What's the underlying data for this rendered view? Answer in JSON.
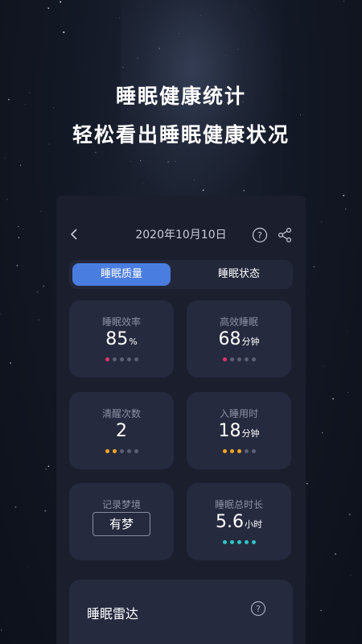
{
  "hero": {
    "title": "睡眠健康统计",
    "subtitle": "轻松看出睡眠健康状况"
  },
  "header": {
    "back_icon": "chevron-left-icon",
    "date": "2020年10月10日",
    "help_icon": "question-circle-icon",
    "share_icon": "share-icon"
  },
  "tabs": [
    {
      "label": "睡眠质量",
      "active": true
    },
    {
      "label": "睡眠状态",
      "active": false
    }
  ],
  "colors": {
    "accent": "#4a7de0",
    "rating_pink": "#e0336f",
    "rating_orange": "#f5a623",
    "rating_teal": "#2ec4c4",
    "rating_off": "#5c6072"
  },
  "stats": {
    "efficiency": {
      "label": "睡眠效率",
      "value": "85",
      "unit": "%",
      "rating": 1,
      "rating_max": 5
    },
    "effective_sleep": {
      "label": "高效睡眠",
      "value": "68",
      "unit": "分钟",
      "rating": 1,
      "rating_max": 5
    },
    "awake_count": {
      "label": "清醒次数",
      "value": "2",
      "unit": "",
      "rating": 2,
      "rating_max": 5
    },
    "fall_asleep": {
      "label": "入睡用时",
      "value": "18",
      "unit": "分钟",
      "rating": 3,
      "rating_max": 5
    },
    "dream": {
      "label": "记录梦境",
      "button": "有梦"
    },
    "total_sleep": {
      "label": "睡眠总时长",
      "value": "5.6",
      "unit": "小时",
      "rating": 5,
      "rating_max": 5
    }
  },
  "radar": {
    "title": "睡眠雷达"
  }
}
